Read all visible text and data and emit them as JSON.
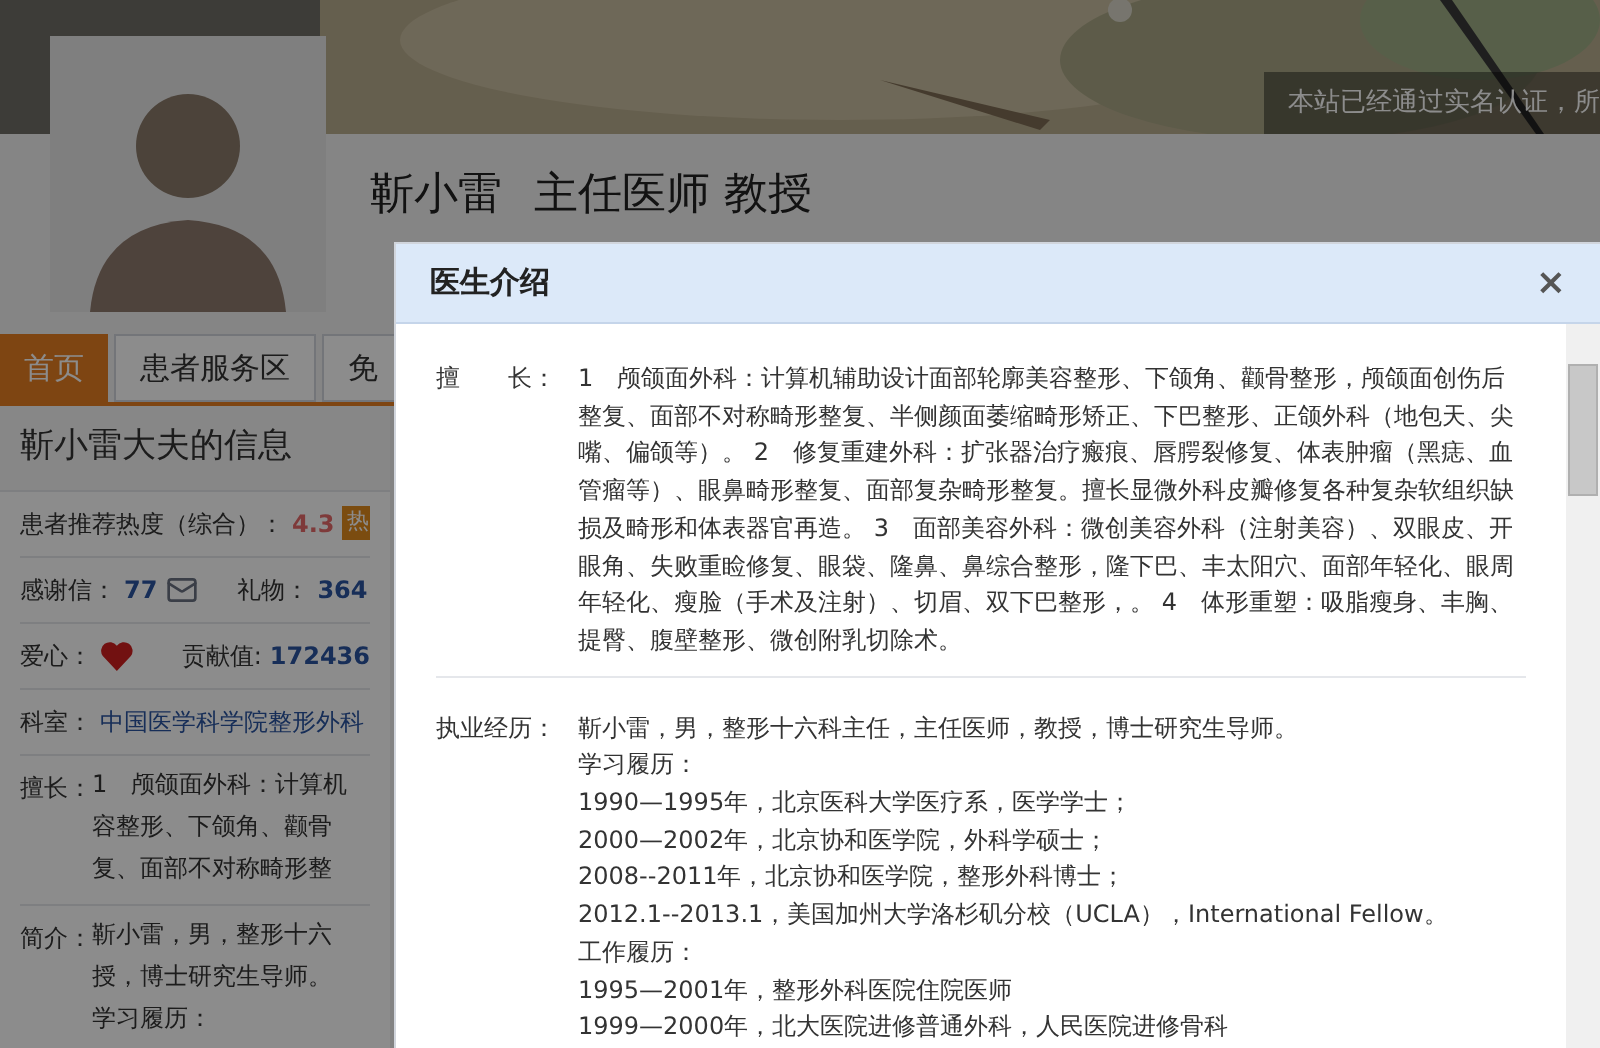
{
  "banner": {
    "notice": "本站已经通过实名认证，所"
  },
  "doctor": {
    "name": "靳小雷",
    "titles": "主任医师 教授"
  },
  "tabs": [
    {
      "label": "首页",
      "selected": true
    },
    {
      "label": "患者服务区",
      "selected": false
    },
    {
      "label": "免",
      "selected": false
    }
  ],
  "info": {
    "title": "靳小雷大夫的信息",
    "rating": {
      "label": "患者推荐热度（综合）：",
      "value": "4.3",
      "badge": "热"
    },
    "thanks": {
      "label": "感谢信：",
      "value": "77"
    },
    "gifts": {
      "label": "礼物：",
      "value": "364"
    },
    "love": {
      "label": "爱心："
    },
    "contribution": {
      "label": "贡献值:",
      "value": "172436"
    },
    "department": {
      "label": "科室：",
      "value": "中国医学科学院整形外科"
    },
    "expertise": {
      "label": "擅长：",
      "lines": [
        "1　颅颌面外科：计算机",
        "容整形、下颌角、颧骨",
        "复、面部不对称畸形整"
      ]
    },
    "intro": {
      "label": "简介：",
      "lines": [
        "靳小雷，男，整形十六",
        "授，博士研究生导师。",
        "学习履历："
      ]
    }
  },
  "dialog": {
    "title": "医生介绍",
    "close": "×",
    "sections": [
      {
        "label": "擅　　长：",
        "lines": [
          "1　颅颌面外科：计算机辅助设计面部轮廓美容整形、下颌角、颧骨整形，颅颌面创伤后整复、面部不对称畸形整复、半侧颜面萎缩畸形矫正、下巴整形、正颌外科（地包天、尖嘴、偏颌等）。 2　修复重建外科：扩张器治疗瘢痕、唇腭裂修复、体表肿瘤（黑痣、血管瘤等）、眼鼻畸形整复、面部复杂畸形整复。擅长显微外科皮瓣修复各种复杂软组织缺损及畸形和体表器官再造。 3　面部美容外科：微创美容外科（注射美容）、双眼皮、开眼角、失败重睑修复、眼袋、隆鼻、鼻综合整形，隆下巴、丰太阳穴、面部年轻化、眼周年轻化、瘦脸（手术及注射）、切眉、双下巴整形，。 4　体形重塑：吸脂瘦身、丰胸、提臀、腹壁整形、微创附乳切除术。"
        ]
      },
      {
        "label": "执业经历：",
        "lines": [
          "靳小雷，男，整形十六科主任，主任医师，教授，博士研究生导师。",
          "学习履历：",
          "1990—1995年，北京医科大学医疗系，医学学士；",
          "2000—2002年，北京协和医学院，外科学硕士；",
          "2008--2011年，北京协和医学院，整形外科博士；",
          "2012.1--2013.1，美国加州大学洛杉矶分校（UCLA），International Fellow。",
          "工作履历：",
          "1995—2001年，整形外科医院住院医师",
          "1999—2000年，北大医院进修普通外科，人民医院进修骨科"
        ]
      }
    ]
  }
}
